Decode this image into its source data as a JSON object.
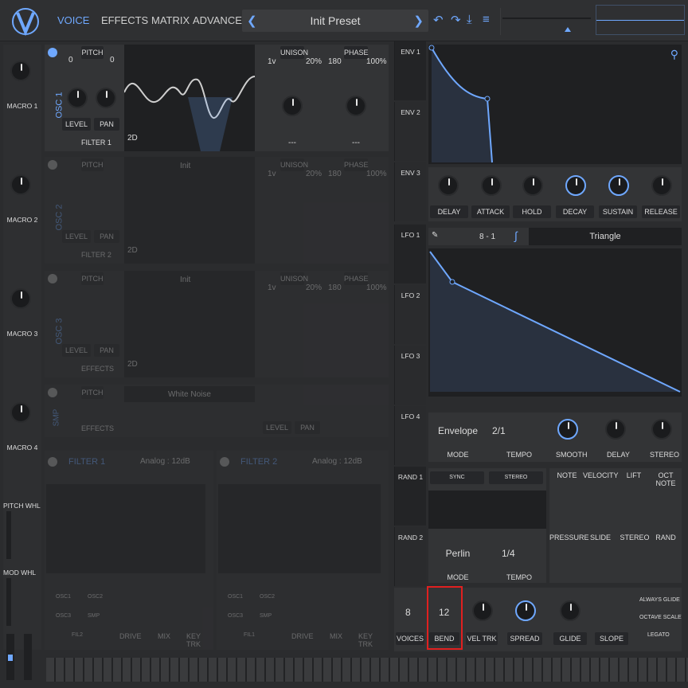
{
  "tabs": [
    "VOICE",
    "EFFECTS",
    "MATRIX",
    "ADVANCED"
  ],
  "preset": {
    "name": "Init Preset",
    "prev": "❮",
    "next": "❯"
  },
  "toolbar": {
    "undo": "↶",
    "redo": "↷",
    "save": "⤓",
    "menu": "≡"
  },
  "macros": [
    "MACRO 1",
    "MACRO 2",
    "MACRO 3",
    "MACRO 4"
  ],
  "wheels": {
    "pitch": "PITCH WHL",
    "mod": "MOD WHL"
  },
  "osc": [
    {
      "title": "OSC 1",
      "pitch": "PITCH",
      "left": "0",
      "right": "0",
      "wave": "",
      "dim": "2D",
      "filter": "FILTER 1",
      "level": "LEVEL",
      "pan": "PAN",
      "unison": "UNISON",
      "phase": "PHASE",
      "v": "1v",
      "p20": "20%",
      "p180": "180",
      "p100": "100%",
      "dash": "---"
    },
    {
      "title": "OSC 2",
      "pitch": "PITCH",
      "left": "0",
      "right": "0",
      "wave": "Init",
      "dim": "2D",
      "filter": "FILTER 2",
      "level": "LEVEL",
      "pan": "PAN",
      "unison": "UNISON",
      "phase": "PHASE",
      "v": "1v",
      "p20": "20%",
      "p180": "180",
      "p100": "100%",
      "dash": "---"
    },
    {
      "title": "OSC 3",
      "pitch": "PITCH",
      "left": "0",
      "right": "0",
      "wave": "Init",
      "dim": "2D",
      "filter": "EFFECTS",
      "level": "LEVEL",
      "pan": "PAN",
      "unison": "UNISON",
      "phase": "PHASE",
      "v": "1v",
      "p20": "20%",
      "p180": "180",
      "p100": "100%",
      "dash": "---"
    }
  ],
  "smp": {
    "title": "SMP",
    "pitch": "PITCH",
    "left": "0",
    "right": "0",
    "noise": "White Noise",
    "effects": "EFFECTS",
    "level": "LEVEL",
    "pan": "PAN"
  },
  "filters": [
    {
      "title": "FILTER 1",
      "type": "Analog : 12dB",
      "drive": "DRIVE",
      "mix": "MIX",
      "keytrk": "KEY TRK"
    },
    {
      "title": "FILTER 2",
      "type": "Analog : 12dB",
      "drive": "DRIVE",
      "mix": "MIX",
      "keytrk": "KEY TRK"
    }
  ],
  "filter_sources": [
    "OSC1",
    "OSC2",
    "OSC3",
    "SMP",
    "FIL2"
  ],
  "filter_sources2": [
    "OSC1",
    "OSC2",
    "OSC3",
    "SMP",
    "FIL1"
  ],
  "env_tabs": [
    "ENV 1",
    "ENV 2",
    "ENV 3"
  ],
  "env_knobs": [
    "DELAY",
    "ATTACK",
    "HOLD",
    "DECAY",
    "SUSTAIN",
    "RELEASE"
  ],
  "lfo_tabs": [
    "LFO 1",
    "LFO 2",
    "LFO 3",
    "LFO 4"
  ],
  "lfo": {
    "grid": "8 - 1",
    "shape": "Triangle",
    "mode_value": "Envelope",
    "mode_label": "MODE",
    "tempo_value": "2/1",
    "tempo_label": "TEMPO",
    "smooth": "SMOOTH",
    "delay": "DELAY",
    "stereo": "STEREO"
  },
  "rand_tabs": [
    "RAND 1",
    "RAND 2"
  ],
  "rand": {
    "sync": "SYNC",
    "stereo": "STEREO",
    "mode_value": "Perlin",
    "mode_label": "MODE",
    "tempo_value": "1/4",
    "tempo_label": "TEMPO"
  },
  "sources": [
    "NOTE",
    "VELOCITY",
    "LIFT",
    "OCT NOTE",
    "PRESSURE",
    "SLIDE",
    "STEREO",
    "RAND"
  ],
  "voice": {
    "voices_value": "8",
    "voices_label": "VOICES",
    "bend_value": "12",
    "bend_label": "BEND",
    "veltrk": "VEL TRK",
    "spread": "SPREAD",
    "glide": "GLIDE",
    "slope": "SLOPE",
    "always_glide": "ALWAYS GLIDE",
    "octave_scale": "OCTAVE SCALE",
    "legato": "LEGATO"
  },
  "colors": {
    "accent": "#6fa8ff",
    "background": "#2b2c2e",
    "panel": "#333436",
    "highlight": "#e02020"
  }
}
